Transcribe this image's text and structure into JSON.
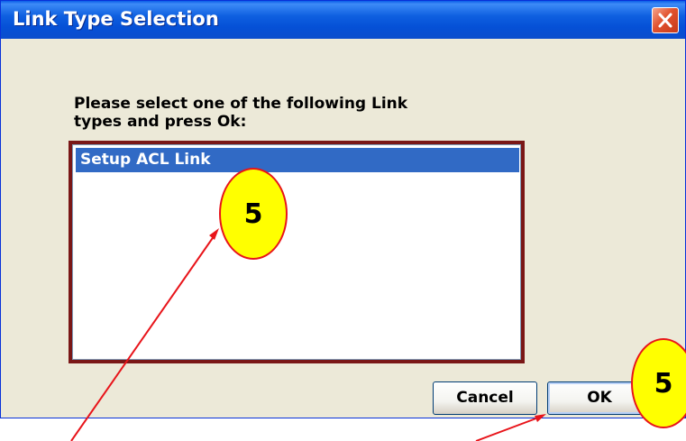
{
  "window": {
    "title": "Link Type Selection",
    "close_icon": "close-icon"
  },
  "dialog": {
    "prompt_line1": "Please select one of the following Link",
    "prompt_line2": "types and press Ok:",
    "list": {
      "items": [
        {
          "label": "Setup ACL Link",
          "selected": true
        }
      ]
    },
    "cancel_label": "Cancel",
    "ok_label": "OK"
  },
  "annotations": {
    "badge_list": "5",
    "badge_ok": "5",
    "badge_fill_color": "#ffff00",
    "badge_border_color": "#e8141a",
    "arrow_color": "#e8141a"
  },
  "colors": {
    "titlebar": "#0550d6",
    "dialog_bg": "#ece9d8",
    "selection": "#316ac5",
    "listbox_border": "#7a1717"
  }
}
